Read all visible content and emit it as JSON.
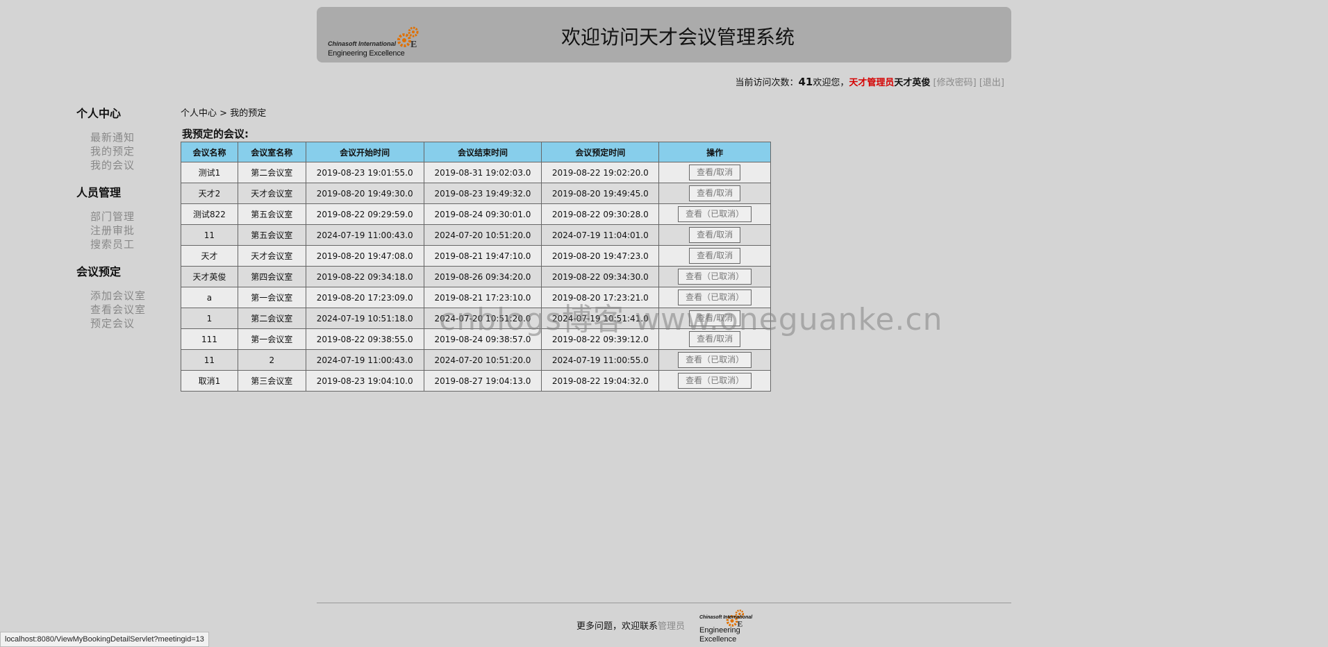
{
  "header": {
    "logo_line1": "Chinasoft International",
    "logo_line2": "Engineering Excellence",
    "title": "欢迎访问天才会议管理系统"
  },
  "topbar": {
    "visits_label": "当前访问次数：",
    "visits_count": "41",
    "welcome": "欢迎您，",
    "role": "天才管理员",
    "username": "天才英俊",
    "change_password": "[修改密码]",
    "logout": "[退出]"
  },
  "sidebar": {
    "sections": [
      {
        "title": "个人中心",
        "items": [
          "最新通知",
          "我的预定",
          "我的会议"
        ]
      },
      {
        "title": "人员管理",
        "items": [
          "部门管理",
          "注册审批",
          "搜索员工"
        ]
      },
      {
        "title": "会议预定",
        "items": [
          "添加会议室",
          "查看会议室",
          "预定会议"
        ]
      }
    ]
  },
  "breadcrumb": {
    "root": "个人中心",
    "sep": ">",
    "current": "我的预定"
  },
  "table": {
    "title": "我预定的会议:",
    "headers": [
      "会议名称",
      "会议室名称",
      "会议开始时间",
      "会议结束时间",
      "会议预定时间",
      "操作"
    ],
    "rows": [
      [
        "测试1",
        "第二会议室",
        "2019-08-23 19:01:55.0",
        "2019-08-31 19:02:03.0",
        "2019-08-22 19:02:20.0",
        "查看/取消"
      ],
      [
        "天才2",
        "天才会议室",
        "2019-08-20 19:49:30.0",
        "2019-08-23 19:49:32.0",
        "2019-08-20 19:49:45.0",
        "查看/取消"
      ],
      [
        "测试822",
        "第五会议室",
        "2019-08-22 09:29:59.0",
        "2019-08-24 09:30:01.0",
        "2019-08-22 09:30:28.0",
        "查看（已取消）"
      ],
      [
        "11",
        "第五会议室",
        "2024-07-19 11:00:43.0",
        "2024-07-20 10:51:20.0",
        "2024-07-19 11:04:01.0",
        "查看/取消"
      ],
      [
        "天才",
        "天才会议室",
        "2019-08-20 19:47:08.0",
        "2019-08-21 19:47:10.0",
        "2019-08-20 19:47:23.0",
        "查看/取消"
      ],
      [
        "天才英俊",
        "第四会议室",
        "2019-08-22 09:34:18.0",
        "2019-08-26 09:34:20.0",
        "2019-08-22 09:34:30.0",
        "查看（已取消）"
      ],
      [
        "a",
        "第一会议室",
        "2019-08-20 17:23:09.0",
        "2019-08-21 17:23:10.0",
        "2019-08-20 17:23:21.0",
        "查看（已取消）"
      ],
      [
        "1",
        "第二会议室",
        "2024-07-19 10:51:18.0",
        "2024-07-20 10:51:20.0",
        "2024-07-19 10:51:41.0",
        "查看/取消"
      ],
      [
        "111",
        "第一会议室",
        "2019-08-22 09:38:55.0",
        "2019-08-24 09:38:57.0",
        "2019-08-22 09:39:12.0",
        "查看/取消"
      ],
      [
        "11",
        "2",
        "2024-07-19 11:00:43.0",
        "2024-07-20 10:51:20.0",
        "2024-07-19 11:00:55.0",
        "查看（已取消）"
      ],
      [
        "取消1",
        "第三会议室",
        "2019-08-23 19:04:10.0",
        "2019-08-27 19:04:13.0",
        "2019-08-22 19:04:32.0",
        "查看（已取消）"
      ]
    ]
  },
  "watermark": "cnblogs博客 www.oneguanke.cn",
  "footer": {
    "text": "更多问题，欢迎联系",
    "admin_link": "管理员",
    "logo_line1": "Chinasoft International",
    "logo_line2": "Engineering Excellence"
  },
  "statusbar": {
    "url": "localhost:8080/ViewMyBookingDetailServlet?meetingid=13"
  }
}
